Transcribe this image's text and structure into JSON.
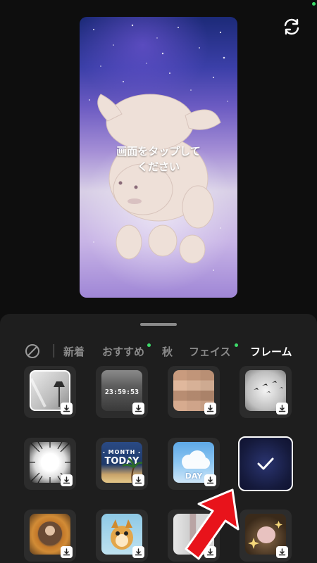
{
  "preview": {
    "hint_line1": "画面をタップして",
    "hint_line2": "ください"
  },
  "tabs": [
    {
      "label": "新着"
    },
    {
      "label": "おすすめ"
    },
    {
      "label": "秋"
    },
    {
      "label": "フェイス"
    },
    {
      "label": "フレーム"
    }
  ],
  "frames": {
    "row1": {
      "clock_text": "23:59:53"
    },
    "row2": {
      "month_text": "- MONTH -",
      "today_text": "TODAY",
      "day_text": "DAY"
    }
  },
  "colors": {
    "accent_dot": "#3ddc6a",
    "panel": "#1e1e1e",
    "arrow": "#e8131b"
  }
}
